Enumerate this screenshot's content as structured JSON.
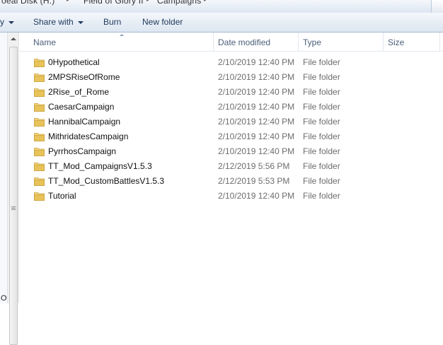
{
  "address": {
    "crumbs": [
      "oeal Disk (H:)",
      "Field of Glory II",
      "Campaigns"
    ]
  },
  "toolbar": {
    "organize_fragment": "y",
    "share_label": "Share with",
    "burn_label": "Burn",
    "new_folder_label": "New folder"
  },
  "nav": {
    "fragment": "O"
  },
  "columns": {
    "name": "Name",
    "date": "Date modified",
    "type": "Type",
    "size": "Size"
  },
  "files": [
    {
      "name": "0Hypothetical",
      "date": "2/10/2019 12:40 PM",
      "type": "File folder",
      "size": ""
    },
    {
      "name": "2MPSRiseOfRome",
      "date": "2/10/2019 12:40 PM",
      "type": "File folder",
      "size": ""
    },
    {
      "name": "2Rise_of_Rome",
      "date": "2/10/2019 12:40 PM",
      "type": "File folder",
      "size": ""
    },
    {
      "name": "CaesarCampaign",
      "date": "2/10/2019 12:40 PM",
      "type": "File folder",
      "size": ""
    },
    {
      "name": "HannibalCampaign",
      "date": "2/10/2019 12:40 PM",
      "type": "File folder",
      "size": ""
    },
    {
      "name": "MithridatesCampaign",
      "date": "2/10/2019 12:40 PM",
      "type": "File folder",
      "size": ""
    },
    {
      "name": "PyrrhosCampaign",
      "date": "2/10/2019 12:40 PM",
      "type": "File folder",
      "size": ""
    },
    {
      "name": "TT_Mod_CampaignsV1.5.3",
      "date": "2/12/2019 5:56 PM",
      "type": "File folder",
      "size": ""
    },
    {
      "name": "TT_Mod_CustomBattlesV1.5.3",
      "date": "2/12/2019 5:53 PM",
      "type": "File folder",
      "size": ""
    },
    {
      "name": "Tutorial",
      "date": "2/10/2019 12:40 PM",
      "type": "File folder",
      "size": ""
    }
  ],
  "colors": {
    "toolbar_top": "#f5f8fc",
    "toolbar_bottom": "#dde6f1",
    "folder": "#e8c35a",
    "header_text": "#4c607a",
    "meta_text": "#6d6d6d"
  }
}
